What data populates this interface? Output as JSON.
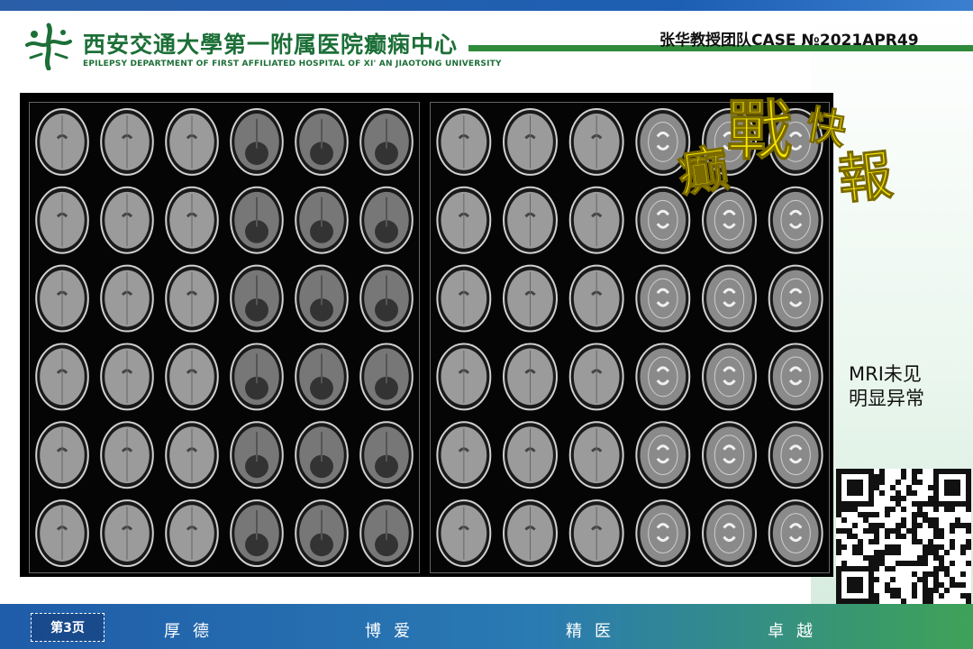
{
  "header": {
    "hospital_name": "西安交通大學第一附属医院癫痫中心",
    "hospital_name_en": "EPILEPSY DEPARTMENT OF FIRST AFFILIATED HOSPITAL OF XI' AN JIAOTONG UNIVERSITY",
    "team_case": "张华教授团队CASE №2021APR49"
  },
  "stamp": {
    "text": "癫戰快報",
    "color": "#f5e600"
  },
  "annotation": {
    "line1": "MRI未见",
    "line2": "明显异常"
  },
  "footer": {
    "page_label": "第3页",
    "motto": [
      "厚德",
      "博爱",
      "精医",
      "卓越"
    ]
  },
  "colors": {
    "brand_green": "#1c6f37",
    "header_blue": "#1d5fb3"
  }
}
